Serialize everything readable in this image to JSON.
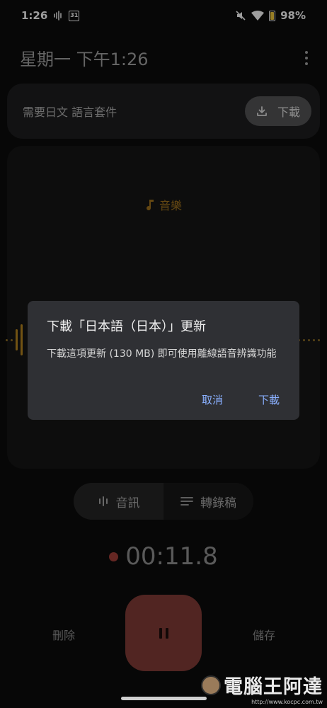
{
  "status_bar": {
    "time": "1:26",
    "calendar_day": "31",
    "battery_percent": "98%"
  },
  "header": {
    "title": "星期一 下午1:26"
  },
  "language_card": {
    "message": "需要日文 語言套件",
    "download_label": "下載"
  },
  "recording": {
    "label": "音樂",
    "timer": "00:11.8"
  },
  "dialog": {
    "title": "下載「日本語（日本）」更新",
    "body": "下載這項更新 (130 MB) 即可使用離線語音辨識功能",
    "cancel_label": "取消",
    "confirm_label": "下載"
  },
  "view_toggle": {
    "audio_label": "音訊",
    "transcript_label": "轉錄稿"
  },
  "controls": {
    "delete_label": "刪除",
    "save_label": "儲存"
  },
  "watermark": {
    "text": "電腦王阿達",
    "url": "http://www.kocpc.com.tw"
  },
  "colors": {
    "background": "#0c0c0c",
    "card": "#1c1c1e",
    "accent_amber": "#b0801e",
    "record_red": "#7d3a35",
    "dialog_action": "#8ab0ff"
  }
}
